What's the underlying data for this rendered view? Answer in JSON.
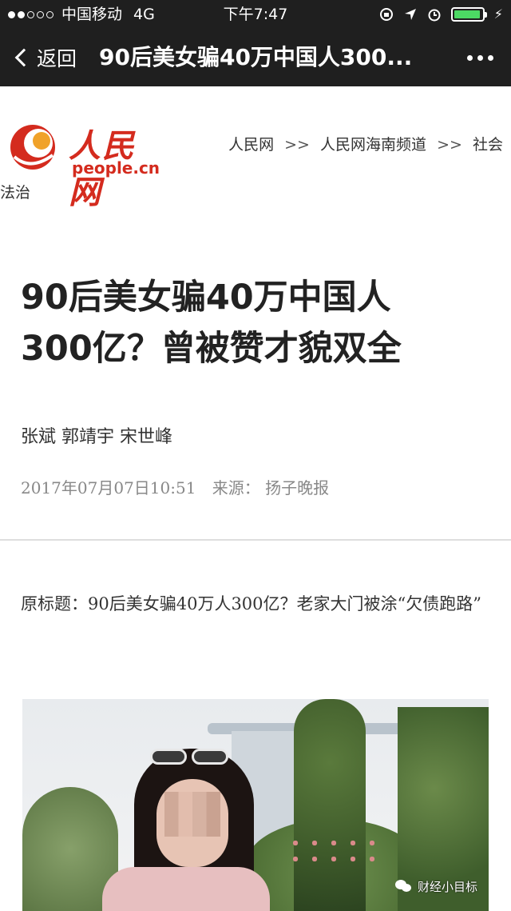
{
  "status_bar": {
    "carrier": "中国移动",
    "network": "4G",
    "time": "下午7:47",
    "battery_level": 0.95
  },
  "nav": {
    "back_label": "返回",
    "title": "90后美女骗40万中国人300...",
    "more_icon": "more-dots-icon"
  },
  "site": {
    "logo_cn": "人民网",
    "logo_en": "people.cn",
    "breadcrumb": {
      "item1": "人民网",
      "sep": ">>",
      "item2": "人民网海南频道",
      "item3": "社会",
      "item3_cont": "法治"
    }
  },
  "article": {
    "title_line1": "90后美女骗40万中国人",
    "title_line2": "300亿？曾被赞才貌双全",
    "authors": "张斌  郭靖宇  宋世峰",
    "datetime": "2017年07月07日10:51",
    "source_label": "来源：",
    "source": "扬子晚报",
    "original_title": "原标题：90后美女骗40万人300亿？老家大门被涂“欠债跑路”"
  },
  "watermark": {
    "text": "财经小目标"
  },
  "colors": {
    "bar_bg": "#1f1f1f",
    "brand_red": "#d42b1e",
    "battery_green": "#4cd964"
  }
}
